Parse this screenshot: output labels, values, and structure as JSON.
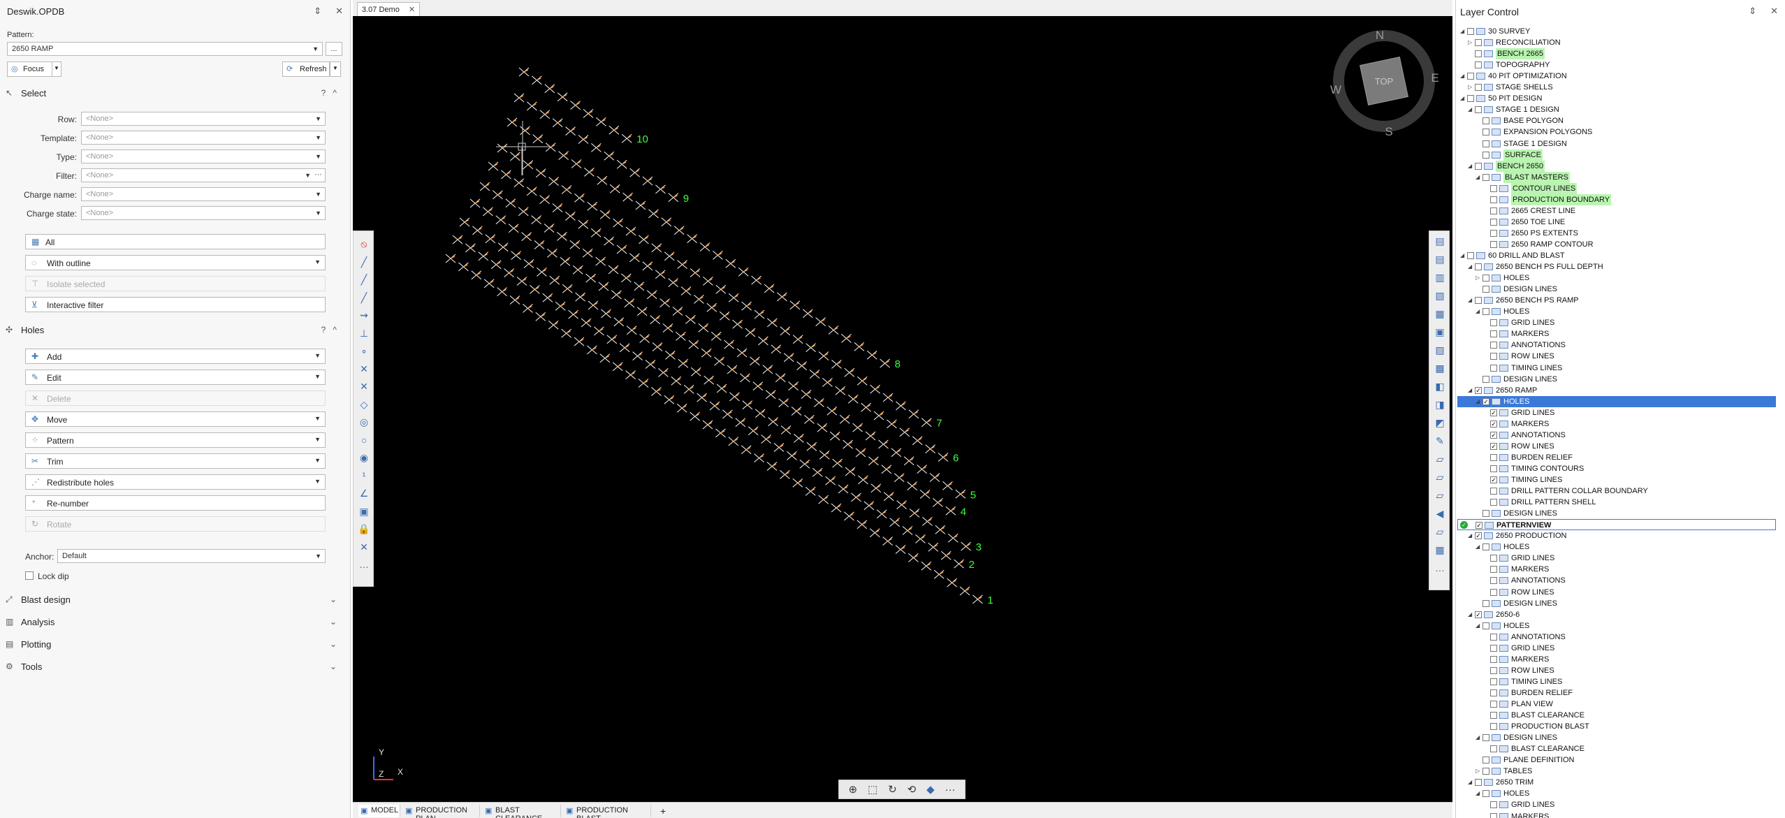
{
  "left_panel": {
    "title": "Deswik.OPDB",
    "pin_icon": "pin-icon",
    "close_icon": "close-icon",
    "pattern_label": "Pattern:",
    "pattern_value": "2650 RAMP",
    "more_button": "...",
    "focus_label": "Focus",
    "refresh_label": "Refresh",
    "select_section": {
      "title": "Select",
      "help": "?",
      "fields": [
        {
          "label": "Row:",
          "value": "<None>"
        },
        {
          "label": "Template:",
          "value": "<None>"
        },
        {
          "label": "Type:",
          "value": "<None>"
        },
        {
          "label": "Filter:",
          "value": "<None>"
        },
        {
          "label": "Charge name:",
          "value": "<None>"
        },
        {
          "label": "Charge state:",
          "value": "<None>"
        }
      ],
      "all_label": "All",
      "with_outline_label": "With outline",
      "isolate_label": "Isolate selected",
      "interactive_filter_label": "Interactive filter"
    },
    "holes_section": {
      "title": "Holes",
      "help": "?",
      "actions": [
        {
          "label": "Add",
          "dropdown": true,
          "disabled": false
        },
        {
          "label": "Edit",
          "dropdown": true,
          "disabled": false
        },
        {
          "label": "Delete",
          "dropdown": false,
          "disabled": true
        },
        {
          "label": "Move",
          "dropdown": true,
          "disabled": false
        },
        {
          "label": "Pattern",
          "dropdown": true,
          "disabled": false
        },
        {
          "label": "Trim",
          "dropdown": true,
          "disabled": false
        },
        {
          "label": "Redistribute holes",
          "dropdown": true,
          "disabled": false
        },
        {
          "label": "Re-number",
          "dropdown": false,
          "disabled": false
        },
        {
          "label": "Rotate",
          "dropdown": false,
          "disabled": true
        }
      ],
      "anchor_label": "Anchor:",
      "anchor_value": "Default",
      "lock_dip_label": "Lock dip"
    },
    "collapsed_sections": [
      "Blast design",
      "Analysis",
      "Plotting",
      "Tools"
    ]
  },
  "viewport": {
    "tab_title": "3.07 Demo",
    "compass": {
      "n": "N",
      "s": "S",
      "e": "E",
      "w": "W",
      "center": "TOP"
    },
    "hole_labels": [
      "10",
      "9",
      "8",
      "7",
      "6",
      "5",
      "4",
      "3",
      "2",
      "1"
    ],
    "axis": {
      "y": "Y",
      "z": "Z",
      "x": "X"
    },
    "nav_more": "···",
    "bottom_tabs": [
      "MODEL",
      "PRODUCTION PLAN",
      "BLAST CLEARANCE",
      "PRODUCTION BLAST"
    ],
    "add_tab": "+",
    "colors": {
      "background": "#000000",
      "hole": "#ffffff",
      "collar": "#ff8c1a",
      "label": "#3cff3c"
    }
  },
  "layer_control": {
    "title": "Layer Control",
    "rows": [
      {
        "name": "30 SURVEY",
        "level": 0,
        "exp": "open",
        "checked": false
      },
      {
        "name": "RECONCILIATION",
        "level": 1,
        "exp": "closed",
        "checked": false
      },
      {
        "name": "BENCH 2665",
        "level": 1,
        "exp": "none",
        "checked": false,
        "hl": true
      },
      {
        "name": "TOPOGRAPHY",
        "level": 1,
        "exp": "none",
        "checked": false
      },
      {
        "name": "40 PIT OPTIMIZATION",
        "level": 0,
        "exp": "open",
        "checked": false
      },
      {
        "name": "STAGE SHELLS",
        "level": 1,
        "exp": "closed",
        "checked": false
      },
      {
        "name": "50 PIT DESIGN",
        "level": 0,
        "exp": "open",
        "checked": false
      },
      {
        "name": "STAGE 1 DESIGN",
        "level": 1,
        "exp": "open",
        "checked": false
      },
      {
        "name": "BASE POLYGON",
        "level": 2,
        "exp": "none",
        "checked": false
      },
      {
        "name": "EXPANSION POLYGONS",
        "level": 2,
        "exp": "none",
        "checked": false
      },
      {
        "name": "STAGE 1 DESIGN",
        "level": 2,
        "exp": "none",
        "checked": false
      },
      {
        "name": "SURFACE",
        "level": 2,
        "exp": "none",
        "checked": false,
        "hl": true
      },
      {
        "name": "BENCH 2650",
        "level": 1,
        "exp": "open",
        "checked": false,
        "hl": true
      },
      {
        "name": "BLAST MASTERS",
        "level": 2,
        "exp": "open",
        "checked": false,
        "hl": true
      },
      {
        "name": "CONTOUR LINES",
        "level": 3,
        "exp": "none",
        "checked": false,
        "hl": true
      },
      {
        "name": "PRODUCTION BOUNDARY",
        "level": 3,
        "exp": "none",
        "checked": false,
        "hl": true
      },
      {
        "name": "2665 CREST LINE",
        "level": 3,
        "exp": "none",
        "checked": false
      },
      {
        "name": "2650 TOE LINE",
        "level": 3,
        "exp": "none",
        "checked": false
      },
      {
        "name": "2650 PS EXTENTS",
        "level": 3,
        "exp": "none",
        "checked": false
      },
      {
        "name": "2650 RAMP CONTOUR",
        "level": 3,
        "exp": "none",
        "checked": false
      },
      {
        "name": "60 DRILL AND BLAST",
        "level": 0,
        "exp": "open",
        "checked": false
      },
      {
        "name": "2650 BENCH PS FULL DEPTH",
        "level": 1,
        "exp": "open",
        "checked": false
      },
      {
        "name": "HOLES",
        "level": 2,
        "exp": "closed",
        "checked": false
      },
      {
        "name": "DESIGN LINES",
        "level": 2,
        "exp": "none",
        "checked": false
      },
      {
        "name": "2650 BENCH PS RAMP",
        "level": 1,
        "exp": "open",
        "checked": false
      },
      {
        "name": "HOLES",
        "level": 2,
        "exp": "open",
        "checked": false
      },
      {
        "name": "GRID LINES",
        "level": 3,
        "exp": "none",
        "checked": false
      },
      {
        "name": "MARKERS",
        "level": 3,
        "exp": "none",
        "checked": false
      },
      {
        "name": "ANNOTATIONS",
        "level": 3,
        "exp": "none",
        "checked": false
      },
      {
        "name": "ROW LINES",
        "level": 3,
        "exp": "none",
        "checked": false
      },
      {
        "name": "TIMING LINES",
        "level": 3,
        "exp": "none",
        "checked": false
      },
      {
        "name": "DESIGN LINES",
        "level": 2,
        "exp": "none",
        "checked": false
      },
      {
        "name": "2650 RAMP",
        "level": 1,
        "exp": "open",
        "checked": true
      },
      {
        "name": "HOLES",
        "level": 2,
        "exp": "open",
        "checked": true,
        "selected": true
      },
      {
        "name": "GRID LINES",
        "level": 3,
        "exp": "none",
        "checked": true
      },
      {
        "name": "MARKERS",
        "level": 3,
        "exp": "none",
        "checked": true
      },
      {
        "name": "ANNOTATIONS",
        "level": 3,
        "exp": "none",
        "checked": true
      },
      {
        "name": "ROW LINES",
        "level": 3,
        "exp": "none",
        "checked": true
      },
      {
        "name": "BURDEN RELIEF",
        "level": 3,
        "exp": "none",
        "checked": false
      },
      {
        "name": "TIMING CONTOURS",
        "level": 3,
        "exp": "none",
        "checked": false
      },
      {
        "name": "TIMING LINES",
        "level": 3,
        "exp": "none",
        "checked": true
      },
      {
        "name": "DRILL PATTERN COLLAR BOUNDARY",
        "level": 3,
        "exp": "none",
        "checked": false
      },
      {
        "name": "DRILL PATTERN SHELL",
        "level": 3,
        "exp": "none",
        "checked": false
      },
      {
        "name": "DESIGN LINES",
        "level": 2,
        "exp": "none",
        "checked": false
      },
      {
        "name": "PATTERNVIEW",
        "level": 1,
        "exp": "none",
        "checked": true,
        "boxed": true
      },
      {
        "name": "2650 PRODUCTION",
        "level": 1,
        "exp": "open",
        "checked": true
      },
      {
        "name": "HOLES",
        "level": 2,
        "exp": "open",
        "checked": false
      },
      {
        "name": "GRID LINES",
        "level": 3,
        "exp": "none",
        "checked": false
      },
      {
        "name": "MARKERS",
        "level": 3,
        "exp": "none",
        "checked": false
      },
      {
        "name": "ANNOTATIONS",
        "level": 3,
        "exp": "none",
        "checked": false
      },
      {
        "name": "ROW LINES",
        "level": 3,
        "exp": "none",
        "checked": false
      },
      {
        "name": "DESIGN LINES",
        "level": 2,
        "exp": "none",
        "checked": false
      },
      {
        "name": "2650-6",
        "level": 1,
        "exp": "open",
        "checked": true
      },
      {
        "name": "HOLES",
        "level": 2,
        "exp": "open",
        "checked": false
      },
      {
        "name": "ANNOTATIONS",
        "level": 3,
        "exp": "none",
        "checked": false
      },
      {
        "name": "GRID LINES",
        "level": 3,
        "exp": "none",
        "checked": false
      },
      {
        "name": "MARKERS",
        "level": 3,
        "exp": "none",
        "checked": false
      },
      {
        "name": "ROW LINES",
        "level": 3,
        "exp": "none",
        "checked": false
      },
      {
        "name": "TIMING LINES",
        "level": 3,
        "exp": "none",
        "checked": false
      },
      {
        "name": "BURDEN RELIEF",
        "level": 3,
        "exp": "none",
        "checked": false
      },
      {
        "name": "PLAN VIEW",
        "level": 3,
        "exp": "none",
        "checked": false
      },
      {
        "name": "BLAST CLEARANCE",
        "level": 3,
        "exp": "none",
        "checked": false
      },
      {
        "name": "PRODUCTION BLAST",
        "level": 3,
        "exp": "none",
        "checked": false
      },
      {
        "name": "DESIGN LINES",
        "level": 2,
        "exp": "open",
        "checked": false
      },
      {
        "name": "BLAST CLEARANCE",
        "level": 3,
        "exp": "none",
        "checked": false
      },
      {
        "name": "PLANE DEFINITION",
        "level": 2,
        "exp": "none",
        "checked": false
      },
      {
        "name": "TABLES",
        "level": 2,
        "exp": "closed",
        "checked": false
      },
      {
        "name": "2650 TRIM",
        "level": 1,
        "exp": "open",
        "checked": false
      },
      {
        "name": "HOLES",
        "level": 2,
        "exp": "open",
        "checked": false
      },
      {
        "name": "GRID LINES",
        "level": 3,
        "exp": "none",
        "checked": false
      },
      {
        "name": "MARKERS",
        "level": 3,
        "exp": "none",
        "checked": false
      }
    ]
  }
}
